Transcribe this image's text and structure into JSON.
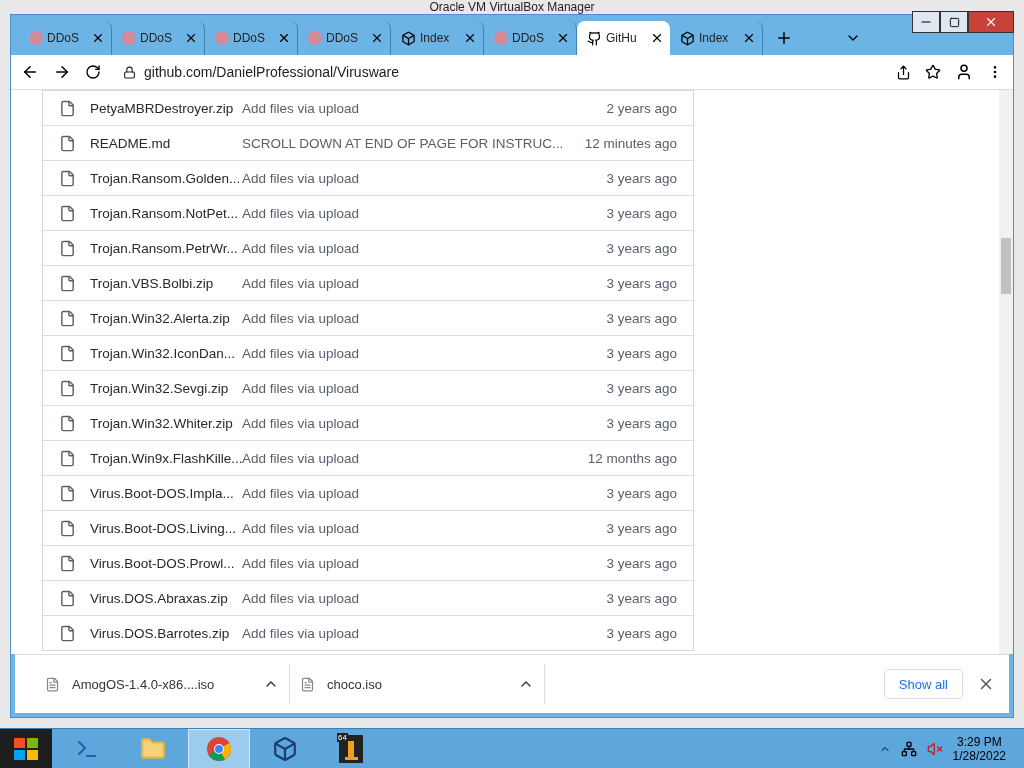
{
  "background_window": {
    "title": "Oracle VM VirtualBox Manager"
  },
  "tabs": [
    {
      "label": "DDoS",
      "kind": "ddos",
      "selected": false
    },
    {
      "label": "DDoS",
      "kind": "ddos",
      "selected": false
    },
    {
      "label": "DDoS",
      "kind": "ddos",
      "selected": false
    },
    {
      "label": "DDoS",
      "kind": "ddos",
      "selected": false
    },
    {
      "label": "Index",
      "kind": "index",
      "selected": false
    },
    {
      "label": "DDoS",
      "kind": "ddos",
      "selected": false
    },
    {
      "label": "GitHu",
      "kind": "github",
      "selected": true
    },
    {
      "label": "Index",
      "kind": "index",
      "selected": false
    }
  ],
  "address_bar": {
    "url": "github.com/DanielProfessional/Virusware"
  },
  "files": [
    {
      "name": "PetyaMBRDestroyer.zip",
      "message": "Add files via upload",
      "age": "2 years ago"
    },
    {
      "name": "README.md",
      "message": "SCROLL DOWN AT END OF PAGE FOR INSTRUC...",
      "age": "12 minutes ago"
    },
    {
      "name": "Trojan.Ransom.Golden...",
      "message": "Add files via upload",
      "age": "3 years ago"
    },
    {
      "name": "Trojan.Ransom.NotPet...",
      "message": "Add files via upload",
      "age": "3 years ago"
    },
    {
      "name": "Trojan.Ransom.PetrWr...",
      "message": "Add files via upload",
      "age": "3 years ago"
    },
    {
      "name": "Trojan.VBS.Bolbi.zip",
      "message": "Add files via upload",
      "age": "3 years ago"
    },
    {
      "name": "Trojan.Win32.Alerta.zip",
      "message": "Add files via upload",
      "age": "3 years ago"
    },
    {
      "name": "Trojan.Win32.IconDan...",
      "message": "Add files via upload",
      "age": "3 years ago"
    },
    {
      "name": "Trojan.Win32.Sevgi.zip",
      "message": "Add files via upload",
      "age": "3 years ago"
    },
    {
      "name": "Trojan.Win32.Whiter.zip",
      "message": "Add files via upload",
      "age": "3 years ago"
    },
    {
      "name": "Trojan.Win9x.FlashKille...",
      "message": "Add files via upload",
      "age": "12 months ago"
    },
    {
      "name": "Virus.Boot-DOS.Impla...",
      "message": "Add files via upload",
      "age": "3 years ago"
    },
    {
      "name": "Virus.Boot-DOS.Living...",
      "message": "Add files via upload",
      "age": "3 years ago"
    },
    {
      "name": "Virus.Boot-DOS.Prowl...",
      "message": "Add files via upload",
      "age": "3 years ago"
    },
    {
      "name": "Virus.DOS.Abraxas.zip",
      "message": "Add files via upload",
      "age": "3 years ago"
    },
    {
      "name": "Virus.DOS.Barrotes.zip",
      "message": "Add files via upload",
      "age": "3 years ago"
    }
  ],
  "downloads": {
    "items": [
      {
        "name": "AmogOS-1.4.0-x86....iso"
      },
      {
        "name": "choco.iso"
      }
    ],
    "show_all": "Show all"
  },
  "taskbar": {
    "apps": [
      {
        "kind": "powershell",
        "selected": false
      },
      {
        "kind": "explorer",
        "selected": false
      },
      {
        "kind": "chrome",
        "selected": true
      },
      {
        "kind": "virtualbox",
        "selected": false
      },
      {
        "kind": "app64",
        "badge": "64",
        "selected": false
      }
    ],
    "time": "3:29 PM",
    "date": "1/28/2022"
  }
}
